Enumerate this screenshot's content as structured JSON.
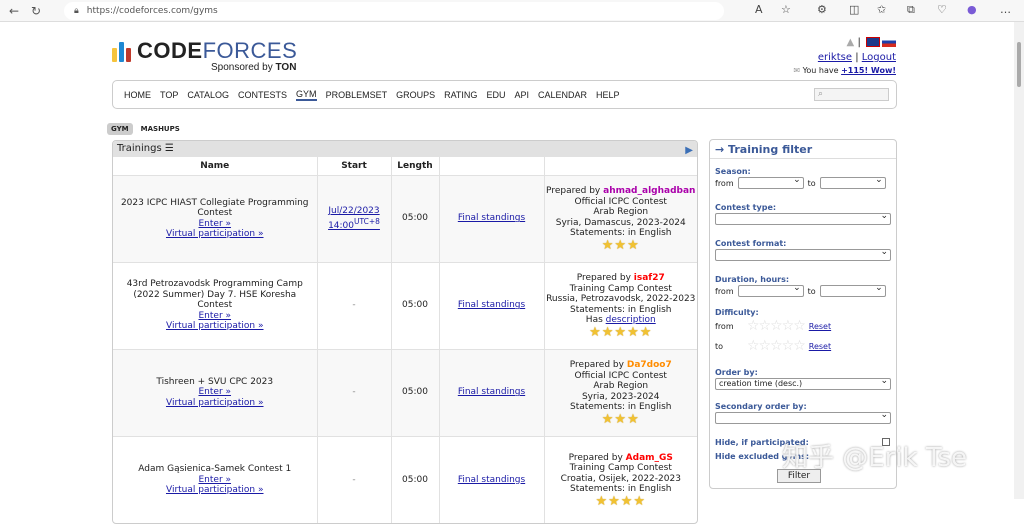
{
  "browser": {
    "url": "https://codeforces.com/gyms"
  },
  "logo": {
    "text_a": "CODE",
    "text_b": "FORCES",
    "sponsor_prefix": "Sponsored by",
    "sponsor": "TON"
  },
  "user": {
    "name": "eriktse",
    "logout": "Logout",
    "sep": "|",
    "you_have": "You have",
    "wow": "+115! Wow!"
  },
  "menu": [
    "HOME",
    "TOP",
    "CATALOG",
    "CONTESTS",
    "GYM",
    "PROBLEMSET",
    "GROUPS",
    "RATING",
    "EDU",
    "API",
    "CALENDAR",
    "HELP"
  ],
  "menu_active": "GYM",
  "subtabs": [
    "GYM",
    "MASHUPS"
  ],
  "trainings": {
    "title": "Trainings",
    "headers": [
      "Name",
      "Start",
      "Length",
      ""
    ],
    "enter": "Enter »",
    "virtual": "Virtual participation »",
    "standings": "Final standings",
    "rows": [
      {
        "name": "2023 ICPC HIAST Collegiate Programming Contest",
        "start": "Jul/22/2023 14:00",
        "tz": "UTC+8",
        "length": "05:00",
        "prepared_label": "Prepared by",
        "author": "ahmad_alghadban",
        "author_color": "#aa00aa",
        "lines": [
          "Official ICPC Contest",
          "Arab Region",
          "Syria, Damascus, 2023-2024",
          "Statements: in English"
        ],
        "stars": 3
      },
      {
        "name": "43rd Petrozavodsk Programming Camp (2022 Summer) Day 7. HSE Koresha Contest",
        "start": "-",
        "length": "05:00",
        "prepared_label": "Prepared by",
        "author": "isaf27",
        "author_color": "#ff0000",
        "lines": [
          "Training Camp Contest",
          "Russia, Petrozavodsk, 2022-2023",
          "Statements: in English"
        ],
        "has": "Has",
        "description": "description",
        "stars": 5
      },
      {
        "name": "Tishreen + SVU CPC 2023",
        "start": "-",
        "length": "05:00",
        "prepared_label": "Prepared by",
        "author": "Da7doo7",
        "author_color": "#ff8c00",
        "lines": [
          "Official ICPC Contest",
          "Arab Region",
          "Syria, 2023-2024",
          "Statements: in English"
        ],
        "stars": 3
      },
      {
        "name": "Adam Gąsienica-Samek Contest 1",
        "start": "-",
        "length": "05:00",
        "prepared_label": "Prepared by",
        "author": "Adam_GS",
        "author_color": "#ff0000",
        "lines": [
          "Training Camp Contest",
          "Croatia, Osijek, 2022-2023",
          "Statements: in English"
        ],
        "stars": 4
      }
    ]
  },
  "filter": {
    "title": "→ Training filter",
    "season": "Season:",
    "from": "from",
    "to": "to",
    "contest_type": "Contest type:",
    "contest_format": "Contest format:",
    "duration": "Duration, hours:",
    "difficulty": "Difficulty:",
    "reset": "Reset",
    "order_by": "Order by:",
    "order_value": "creation time (desc.)",
    "secondary": "Secondary order by:",
    "hide_participated": "Hide, if participated:",
    "hide_excluded": "Hide excluded gyms:",
    "filter_btn": "Filter"
  },
  "watermark": "知乎 @Erik Tse"
}
